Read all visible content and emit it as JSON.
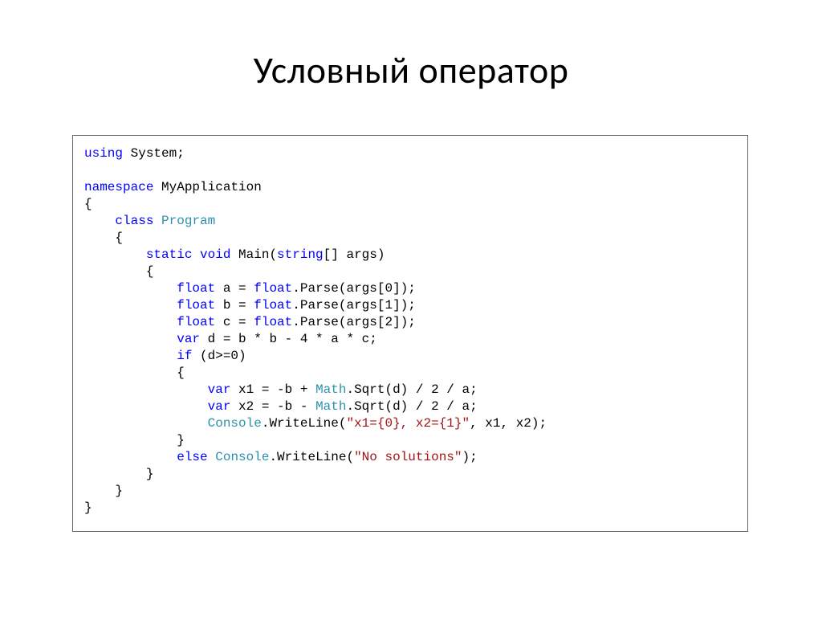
{
  "title": "Условный оператор",
  "code": {
    "l01_kw_using": "using",
    "l01_rest": " System;",
    "l03_kw_ns": "namespace",
    "l03_rest": " MyApplication",
    "l04": "{",
    "l05_indent": "    ",
    "l05_kw_class": "class",
    "l05_sp": " ",
    "l05_type": "Program",
    "l06": "    {",
    "l07_indent": "        ",
    "l07_kw1": "static",
    "l07_sp1": " ",
    "l07_kw2": "void",
    "l07_mid": " Main(",
    "l07_kw3": "string",
    "l07_rest": "[] args)",
    "l08": "        {",
    "l09_indent": "            ",
    "l09_kw": "float",
    "l09_mid": " a = ",
    "l09_kw2": "float",
    "l09_rest": ".Parse(args[0]);",
    "l10_indent": "            ",
    "l10_kw": "float",
    "l10_mid": " b = ",
    "l10_kw2": "float",
    "l10_rest": ".Parse(args[1]);",
    "l11_indent": "            ",
    "l11_kw": "float",
    "l11_mid": " c = ",
    "l11_kw2": "float",
    "l11_rest": ".Parse(args[2]);",
    "l12_indent": "            ",
    "l12_kw": "var",
    "l12_rest": " d = b * b - 4 * a * c;",
    "l13_indent": "            ",
    "l13_kw": "if",
    "l13_rest": " (d>=0)",
    "l14": "            {",
    "l15_indent": "                ",
    "l15_kw": "var",
    "l15_mid": " x1 = -b + ",
    "l15_type": "Math",
    "l15_rest": ".Sqrt(d) / 2 / a;",
    "l16_indent": "                ",
    "l16_kw": "var",
    "l16_mid": " x2 = -b - ",
    "l16_type": "Math",
    "l16_rest": ".Sqrt(d) / 2 / a;",
    "l17_indent": "                ",
    "l17_type": "Console",
    "l17_mid": ".WriteLine(",
    "l17_str": "\"x1={0}, x2={1}\"",
    "l17_rest": ", x1, x2);",
    "l18": "            }",
    "l19_indent": "            ",
    "l19_kw": "else",
    "l19_sp": " ",
    "l19_type": "Console",
    "l19_mid": ".WriteLine(",
    "l19_str": "\"No solutions\"",
    "l19_rest": ");",
    "l20": "        }",
    "l21": "    }",
    "l22": "}"
  }
}
